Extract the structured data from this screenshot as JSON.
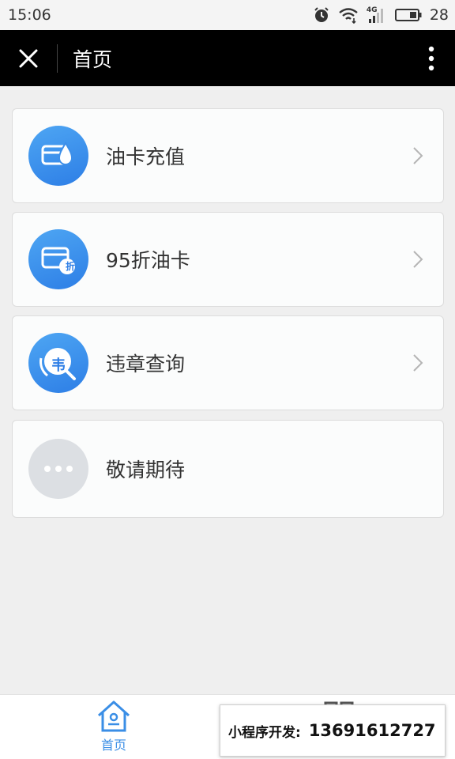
{
  "status_bar": {
    "time": "15:06",
    "network": "4G",
    "battery": "28"
  },
  "title_bar": {
    "title": "首页"
  },
  "menu": {
    "items": [
      {
        "label": "油卡充值",
        "icon": "fuel-card-recharge-icon",
        "badge": ""
      },
      {
        "label": "95折油卡",
        "icon": "discount-card-icon",
        "badge": "折"
      },
      {
        "label": "违章查询",
        "icon": "violation-query-icon",
        "badge": "韦"
      },
      {
        "label": "敬请期待",
        "icon": "more-dots-icon",
        "badge": ""
      }
    ]
  },
  "tab_bar": {
    "home_label": "首页"
  },
  "promo": {
    "label": "小程序开发:",
    "phone": "13691612727"
  },
  "colors": {
    "accent": "#3a8ee6",
    "titlebar_bg": "#000000",
    "page_bg": "#efefef"
  }
}
